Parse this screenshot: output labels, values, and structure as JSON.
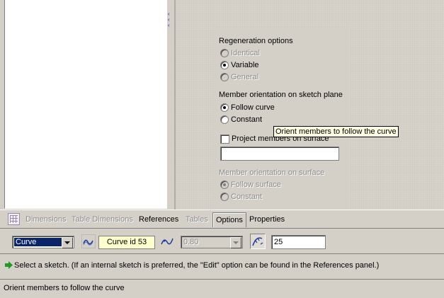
{
  "options_panel": {
    "regeneration": {
      "title": "Regeneration options",
      "options": [
        {
          "label": "Identical",
          "selected": false,
          "enabled": false
        },
        {
          "label": "Variable",
          "selected": true,
          "enabled": true
        },
        {
          "label": "General",
          "selected": false,
          "enabled": false
        }
      ]
    },
    "sketch_orientation": {
      "title": "Member orientation on sketch plane",
      "options": [
        {
          "label": "Follow curve",
          "selected": true,
          "enabled": true
        },
        {
          "label": "Constant",
          "selected": false,
          "enabled": true
        }
      ]
    },
    "project_members": {
      "label": "Project members on surface",
      "checked": false,
      "value": ""
    },
    "surface_orientation": {
      "title": "Member orientation on surface",
      "options": [
        {
          "label": "Follow surface",
          "selected": true,
          "enabled": false
        },
        {
          "label": "Constant",
          "selected": false,
          "enabled": false
        }
      ]
    }
  },
  "tooltip": "Orient members to follow the curve",
  "tabs": [
    {
      "label": "Dimensions",
      "enabled": false
    },
    {
      "label": "Table Dimensions",
      "enabled": false
    },
    {
      "label": "References",
      "enabled": true
    },
    {
      "label": "Tables",
      "enabled": false
    },
    {
      "label": "Options",
      "enabled": true,
      "active": true
    },
    {
      "label": "Properties",
      "enabled": true
    }
  ],
  "controls": {
    "type_select": "Curve",
    "curve_collector": "Curve id 53",
    "ratio_select": "0.80",
    "count_value": "25"
  },
  "message": "Select a sketch. (If an internal sketch is preferred, the \"Edit\" option can be found in the References panel.)",
  "status": "Orient members to follow the curve",
  "colors": {
    "selection": "#0a246a",
    "collector_bg": "#ffffcc",
    "tooltip_bg": "#ffffe1",
    "message_arrow": "#1e9a1e"
  }
}
